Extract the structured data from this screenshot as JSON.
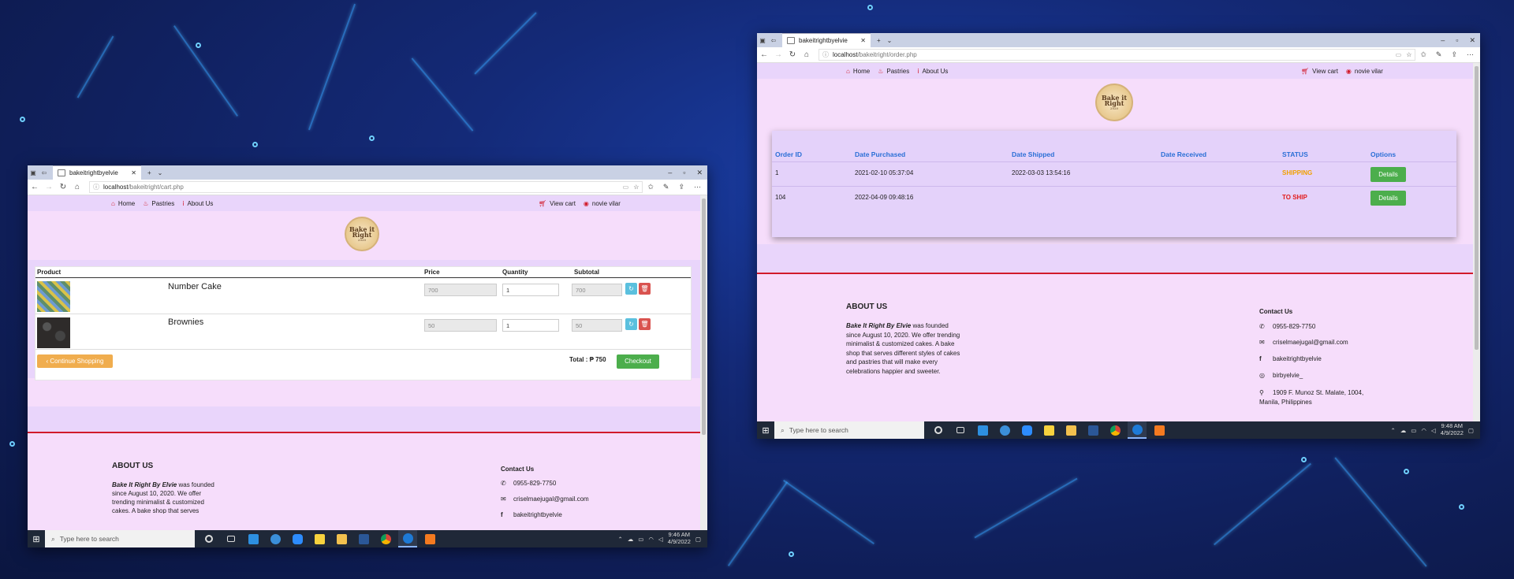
{
  "colors": {
    "nav_red": "#d11a2a",
    "shipping": "#f0a000",
    "to_ship": "#e21b1b",
    "details_btn": "#4cae4c",
    "continue_btn": "#f0ad4e",
    "refresh_btn": "#5bc0de",
    "delete_btn": "#d9534f",
    "header_blue": "#2a6fd6"
  },
  "left": {
    "tab_title": "bakeitrightbyelvie",
    "url_host": "localhost",
    "url_path": "/bakeitright/cart.php",
    "nav": {
      "home": "Home",
      "pastries": "Pastries",
      "about": "About Us",
      "view_cart": "View cart",
      "user": "novie vilar"
    },
    "logo": {
      "line1": "Bake it",
      "line2": "Right",
      "line3": "2020"
    },
    "cart": {
      "headers": [
        "Product",
        "Price",
        "Quantity",
        "Subtotal"
      ],
      "rows": [
        {
          "name": "Number Cake",
          "price": "700",
          "quantity": "1",
          "subtotal": "700",
          "thumb": "#5f8f6a"
        },
        {
          "name": "Brownies",
          "price": "50",
          "quantity": "1",
          "subtotal": "50",
          "thumb": "#2e2b2a"
        }
      ],
      "continue_label": "‹ Continue Shopping",
      "total_label": "Total : ₱ 750",
      "checkout_label": "Checkout"
    },
    "footer": {
      "about_title": "ABOUT US",
      "about_brand": "Bake It Right By Elvie",
      "about_text": " was founded since August 10, 2020. We offer trending minimalist & customized cakes. A bake shop that serves",
      "contact_title": "Contact Us",
      "phone": "0955-829-7750",
      "email": "criselmaejugal@gmail.com",
      "facebook": "bakeitrightbyelvie"
    },
    "taskbar": {
      "search": "Type here to search",
      "time": "9:46 AM",
      "date": "4/9/2022"
    }
  },
  "right": {
    "tab_title": "bakeitrightbyelvie",
    "url_host": "localhost",
    "url_path": "/bakeitright/order.php",
    "nav": {
      "home": "Home",
      "pastries": "Pastries",
      "about": "About Us",
      "view_cart": "View cart",
      "user": "novie vilar"
    },
    "logo": {
      "line1": "Bake it",
      "line2": "Right",
      "line3": "2020"
    },
    "orders": {
      "headers": [
        "Order ID",
        "Date Purchased",
        "Date Shipped",
        "Date Received",
        "STATUS",
        "Options"
      ],
      "rows": [
        {
          "id": "1",
          "purchased": "2021-02-10 05:37:04",
          "shipped": "2022-03-03 13:54:16",
          "received": "",
          "status": "SHIPPING",
          "option": "Details"
        },
        {
          "id": "104",
          "purchased": "2022-04-09 09:48:16",
          "shipped": "",
          "received": "",
          "status": "TO SHIP",
          "option": "Details"
        }
      ]
    },
    "footer": {
      "about_title": "ABOUT US",
      "about_brand": "Bake It Right By Elvie",
      "about_text": " was founded since August 10, 2020. We offer trending minimalist & customized cakes. A bake shop that serves different styles of cakes and pastries that will make every celebrations happier and sweeter.",
      "contact_title": "Contact Us",
      "phone": "0955-829-7750",
      "email": "criselmaejugal@gmail.com",
      "facebook": "bakeitrightbyelvie",
      "instagram": "birbyelvie_",
      "address": "1909 F. Munoz St. Malate, 1004, Manila, Philippines"
    },
    "taskbar": {
      "search": "Type here to search",
      "time": "9:48 AM",
      "date": "4/9/2022"
    }
  }
}
